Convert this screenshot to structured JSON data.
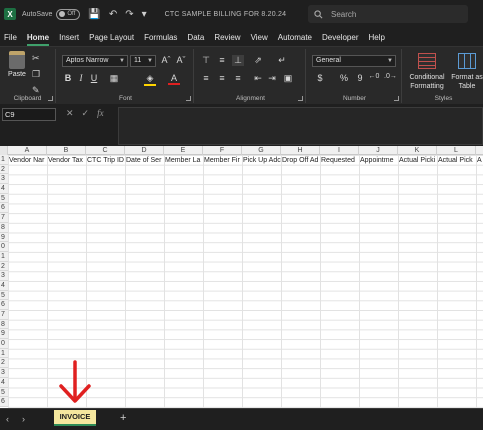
{
  "titlebar": {
    "autosave_label": "AutoSave",
    "autosave_state": "Off",
    "doc_title": "CTC SAMPLE BILLING FOR 8.20.24",
    "search_placeholder": "Search"
  },
  "menu": [
    "File",
    "Home",
    "Insert",
    "Page Layout",
    "Formulas",
    "Data",
    "Review",
    "View",
    "Automate",
    "Developer",
    "Help"
  ],
  "menu_active": "Home",
  "ribbon": {
    "paste_label": "Paste",
    "font_name": "Aptos Narrow",
    "font_size": "11",
    "number_format": "General",
    "conditional_formatting": [
      "Conditional",
      "Formatting"
    ],
    "format_as_table": [
      "Format as",
      "Table"
    ],
    "group_labels": {
      "clipboard": "Clipboard",
      "font": "Font",
      "alignment": "Alignment",
      "number": "Number",
      "styles": "Styles"
    }
  },
  "formula_bar": {
    "name_box": "C9",
    "fx": "fx"
  },
  "grid": {
    "columns": [
      "A",
      "B",
      "C",
      "D",
      "E",
      "F",
      "G",
      "H",
      "I",
      "J",
      "K",
      "L"
    ],
    "row_numbers": [
      "1",
      "2",
      "3",
      "4",
      "5",
      "6",
      "7",
      "8",
      "9",
      "0",
      "1",
      "2",
      "3",
      "4",
      "5",
      "6",
      "7",
      "8",
      "9",
      "0",
      "1",
      "2",
      "3",
      "4",
      "5",
      "6"
    ],
    "header_row": [
      "Vendor Nar",
      "Vendor Tax",
      "CTC Trip ID",
      "Date of Ser",
      "Member La",
      "Member Fir",
      "Pick Up Adc",
      "Drop Off Ad",
      "Requested",
      "Appointme",
      "Actual Picki",
      "Actual Pick",
      "A"
    ]
  },
  "sheets": {
    "tabs": [
      "INVOICE"
    ],
    "active": "INVOICE"
  },
  "colors": {
    "excel_green": "#1d6f42",
    "annotation_red": "#e02020",
    "tab_highlight": "#f5e79e"
  }
}
